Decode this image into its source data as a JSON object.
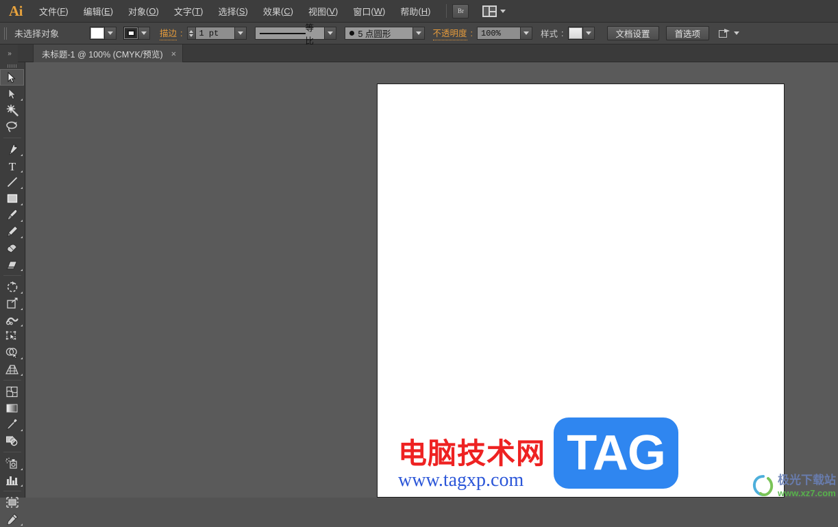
{
  "app": {
    "name": "Ai",
    "logo_color": "#e8a33d"
  },
  "menubar": {
    "items": [
      {
        "label": "文件",
        "accel": "F"
      },
      {
        "label": "编辑",
        "accel": "E"
      },
      {
        "label": "对象",
        "accel": "O"
      },
      {
        "label": "文字",
        "accel": "T"
      },
      {
        "label": "选择",
        "accel": "S"
      },
      {
        "label": "效果",
        "accel": "C"
      },
      {
        "label": "视图",
        "accel": "V"
      },
      {
        "label": "窗口",
        "accel": "W"
      },
      {
        "label": "帮助",
        "accel": "H"
      }
    ],
    "bridge_button": "Br",
    "arrange_icon": "arrange-documents-icon"
  },
  "controlbar": {
    "selection_status": "未选择对象",
    "fill_label": "fill-swatch",
    "fill_color": "#ffffff",
    "stroke_swatch_label": "stroke-swatch",
    "stroke_label": "描边",
    "stroke_colon": ":",
    "stroke_weight": "1 pt",
    "stroke_profile": "等比",
    "brush_definition": "5 点圆形",
    "opacity_label": "不透明度",
    "opacity_colon": ":",
    "opacity_value": "100%",
    "style_label": "样式",
    "style_colon": ":",
    "document_setup": "文档设置",
    "preferences": "首选项",
    "screen_mode_icon": "screen-mode-icon",
    "accent_color": "#e59b3c"
  },
  "tabbar": {
    "collapse_glyph": "»",
    "document_tab": "未标题-1 @ 100% (CMYK/预览)",
    "close_glyph": "×"
  },
  "toolbar": {
    "groups": [
      [
        {
          "name": "selection-tool",
          "active": true,
          "flyout": false
        },
        {
          "name": "direct-selection-tool",
          "active": false,
          "flyout": true
        },
        {
          "name": "magic-wand-tool",
          "active": false,
          "flyout": false
        },
        {
          "name": "lasso-tool",
          "active": false,
          "flyout": false
        }
      ],
      [
        {
          "name": "pen-tool",
          "active": false,
          "flyout": true
        },
        {
          "name": "type-tool",
          "active": false,
          "flyout": true
        },
        {
          "name": "line-segment-tool",
          "active": false,
          "flyout": true
        },
        {
          "name": "rectangle-tool",
          "active": false,
          "flyout": true
        },
        {
          "name": "paintbrush-tool",
          "active": false,
          "flyout": true
        },
        {
          "name": "pencil-tool",
          "active": false,
          "flyout": true
        },
        {
          "name": "blob-brush-tool",
          "active": false,
          "flyout": false
        },
        {
          "name": "eraser-tool",
          "active": false,
          "flyout": true
        }
      ],
      [
        {
          "name": "rotate-tool",
          "active": false,
          "flyout": true
        },
        {
          "name": "scale-tool",
          "active": false,
          "flyout": true
        },
        {
          "name": "width-tool",
          "active": false,
          "flyout": true
        },
        {
          "name": "free-transform-tool",
          "active": false,
          "flyout": false
        },
        {
          "name": "shape-builder-tool",
          "active": false,
          "flyout": true
        },
        {
          "name": "perspective-grid-tool",
          "active": false,
          "flyout": true
        }
      ],
      [
        {
          "name": "mesh-tool",
          "active": false,
          "flyout": false
        },
        {
          "name": "gradient-tool",
          "active": false,
          "flyout": false
        },
        {
          "name": "eyedropper-tool",
          "active": false,
          "flyout": true
        },
        {
          "name": "blend-tool",
          "active": false,
          "flyout": false
        }
      ],
      [
        {
          "name": "symbol-sprayer-tool",
          "active": false,
          "flyout": true
        },
        {
          "name": "column-graph-tool",
          "active": false,
          "flyout": true
        }
      ],
      [
        {
          "name": "artboard-tool",
          "active": false,
          "flyout": false
        },
        {
          "name": "slice-tool",
          "active": false,
          "flyout": true
        }
      ]
    ]
  },
  "canvas": {
    "background_color": "#5a5a5a",
    "artboard_color": "#ffffff",
    "zoom": "100%"
  },
  "watermark": {
    "cn_text": "电脑技术网",
    "url_text": "www.tagxp.com",
    "badge_text": "TAG",
    "cn_color": "#ee2222",
    "url_color": "#2b56d8",
    "badge_color": "#2f86f0"
  },
  "site_watermark": {
    "cn_text": "极光下载站",
    "url_text": "www.xz7.com",
    "cn_color": "#6a7fb5",
    "url_color": "#57b94a"
  }
}
